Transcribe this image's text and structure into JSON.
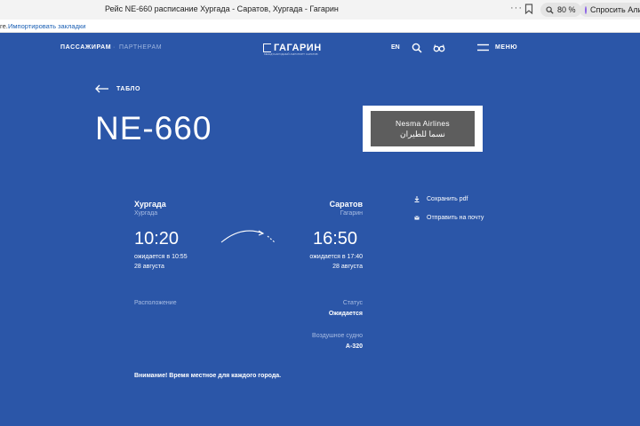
{
  "browser": {
    "tab_title": "Рейс NE-660 расписание Хургада - Саратов, Хургада - Гагарин",
    "more_icon": "more-dots-icon",
    "zoom": "80 %",
    "ask_label": "Спросить Алису",
    "bookmarks_prefix": "ге.",
    "bookmarks_import": "Импортировать закладки"
  },
  "header": {
    "nav_passengers": "ПАССАЖИРАМ",
    "nav_separator": "·",
    "nav_partners": "ПАРТНЕРАМ",
    "logo_text": "ГАГАРИН",
    "logo_sub": "МЕЖДУНАРОДНЫЙ АЭРОПОРТ САРАТОВ",
    "lang": "EN",
    "menu": "МЕНЮ"
  },
  "main": {
    "back_label": "ТАБЛО",
    "flight_number": "NE-660",
    "airline_en": "Nesma Airlines",
    "airline_ar": "نسما للطيران"
  },
  "departure": {
    "city": "Хургада",
    "airport": "Хургада",
    "time": "10:20",
    "expected": "ожидается в 10:55",
    "date": "28 августа"
  },
  "arrival": {
    "city": "Саратов",
    "airport": "Гагарин",
    "time": "16:50",
    "expected": "ожидается в 17:40",
    "date": "28 августа"
  },
  "actions": {
    "save_pdf": "Сохранить pdf",
    "send_mail": "Отправить на почту"
  },
  "details": {
    "location_label": "Расположение",
    "status_label": "Статус",
    "status_value": "Ожидается",
    "aircraft_label": "Воздушное судно",
    "aircraft_value": "A-320"
  },
  "notice": "Внимание! Время местное для каждого города."
}
